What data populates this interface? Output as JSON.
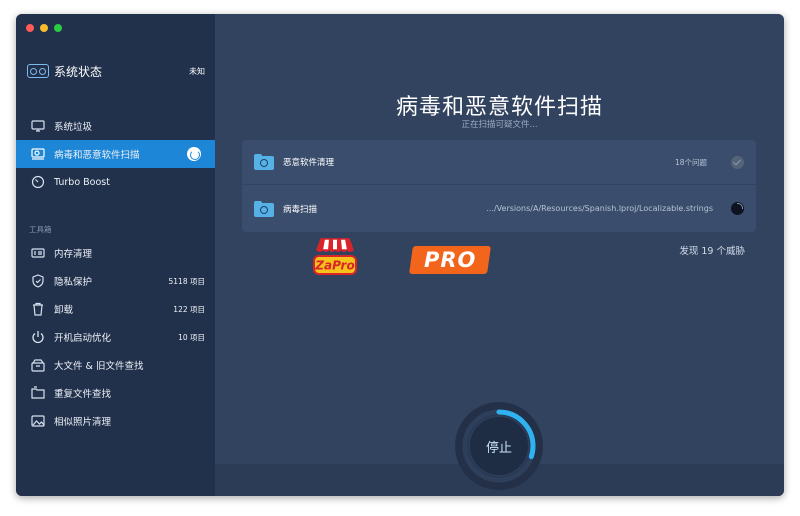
{
  "window": {
    "traffic_lights": [
      "close",
      "minimize",
      "zoom"
    ]
  },
  "sidebar": {
    "status": {
      "title": "系统状态",
      "value": "未知",
      "icon": "system-status-icon"
    },
    "items": [
      {
        "label": "系统垃圾",
        "icon": "monitor-icon",
        "active": false
      },
      {
        "label": "病毒和恶意软件扫描",
        "icon": "scan-monitor-icon",
        "active": true
      },
      {
        "label": "Turbo Boost",
        "icon": "speedometer-icon",
        "active": false
      }
    ],
    "section_label": "工具箱",
    "tools": [
      {
        "label": "内存清理",
        "count": "",
        "icon": "memory-icon"
      },
      {
        "label": "隐私保护",
        "count": "5118 项目",
        "icon": "shield-icon"
      },
      {
        "label": "卸载",
        "count": "122 项目",
        "icon": "trash-icon"
      },
      {
        "label": "开机启动优化",
        "count": "10 项目",
        "icon": "power-icon"
      },
      {
        "label": "大文件 & 旧文件查找",
        "count": "",
        "icon": "box-icon"
      },
      {
        "label": "重复文件查找",
        "count": "",
        "icon": "folders-icon"
      },
      {
        "label": "相似照片清理",
        "count": "",
        "icon": "photo-icon"
      }
    ]
  },
  "main": {
    "title": "病毒和恶意软件扫描",
    "subtitle": "正在扫描可疑文件...",
    "rows": [
      {
        "name": "恶意软件清理",
        "detail": "18个问题",
        "state": "done"
      },
      {
        "name": "病毒扫描",
        "detail": ".../Versions/A/Resources/Spanish.lproj/Localizable.strings",
        "state": "scanning"
      }
    ],
    "found_text": "发现 19  个威胁",
    "stop_label": "停止",
    "progress": 0.3
  },
  "watermark": {
    "logo_text": "ZaPro",
    "badge_text": "PRO"
  },
  "colors": {
    "sidebar_bg": "#21304b",
    "main_bg": "#324360",
    "accent": "#1d86d6",
    "badge": "#f2651a"
  }
}
